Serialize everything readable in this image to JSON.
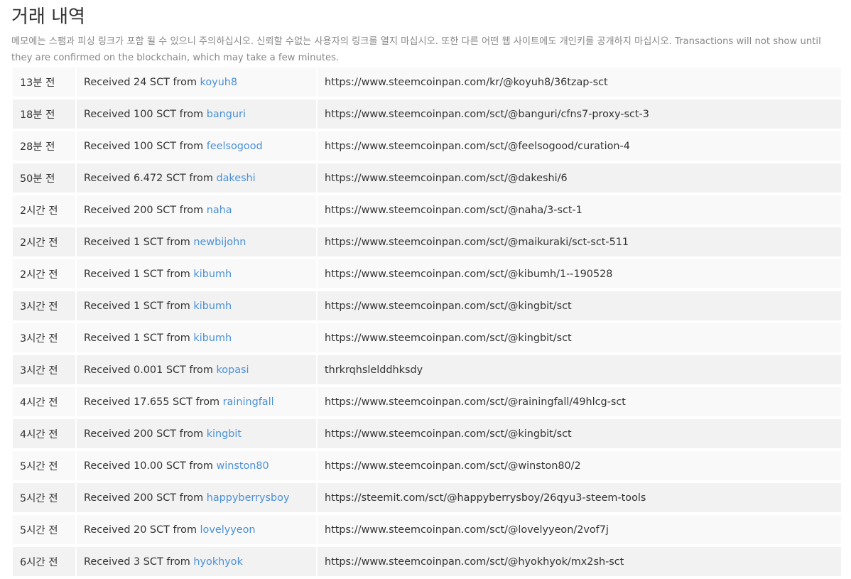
{
  "page": {
    "title": "거래 내역",
    "notice": "메모에는 스팸과 피싱 링크가 포함 될 수 있으니 주의하십시오. 신뢰할 수없는 사용자의 링크를 열지 마십시오. 또한 다른 어떤 웹 사이트에도 개인키를 공개하지 마십시오. Transactions will not show until they are confirmed on the blockchain, which may take a few minutes."
  },
  "colors": {
    "link": "#4a90d9",
    "text": "#333333",
    "muted": "#878787",
    "row_odd": "#f9f9f9",
    "row_even": "#f2f2f2"
  },
  "transactions": [
    {
      "time": "13분 전",
      "prefix": "Received 24 SCT from ",
      "sender": "koyuh8",
      "memo": "https://www.steemcoinpan.com/kr/@koyuh8/36tzap-sct"
    },
    {
      "time": "18분 전",
      "prefix": "Received 100 SCT from ",
      "sender": "banguri",
      "memo": "https://www.steemcoinpan.com/sct/@banguri/cfns7-proxy-sct-3"
    },
    {
      "time": "28분 전",
      "prefix": "Received 100 SCT from ",
      "sender": "feelsogood",
      "memo": "https://www.steemcoinpan.com/sct/@feelsogood/curation-4"
    },
    {
      "time": "50분 전",
      "prefix": "Received 6.472 SCT from ",
      "sender": "dakeshi",
      "memo": "https://www.steemcoinpan.com/sct/@dakeshi/6"
    },
    {
      "time": "2시간 전",
      "prefix": "Received 200 SCT from ",
      "sender": "naha",
      "memo": "https://www.steemcoinpan.com/sct/@naha/3-sct-1"
    },
    {
      "time": "2시간 전",
      "prefix": "Received 1 SCT from ",
      "sender": "newbijohn",
      "memo": "https://www.steemcoinpan.com/sct/@maikuraki/sct-sct-511"
    },
    {
      "time": "2시간 전",
      "prefix": "Received 1 SCT from ",
      "sender": "kibumh",
      "memo": "https://www.steemcoinpan.com/sct/@kibumh/1--190528"
    },
    {
      "time": "3시간 전",
      "prefix": "Received 1 SCT from ",
      "sender": "kibumh",
      "memo": "https://www.steemcoinpan.com/sct/@kingbit/sct"
    },
    {
      "time": "3시간 전",
      "prefix": "Received 1 SCT from ",
      "sender": "kibumh",
      "memo": "https://www.steemcoinpan.com/sct/@kingbit/sct"
    },
    {
      "time": "3시간 전",
      "prefix": "Received 0.001 SCT from ",
      "sender": "kopasi",
      "memo": "thrkrqhslelddhksdy"
    },
    {
      "time": "4시간 전",
      "prefix": "Received 17.655 SCT from ",
      "sender": "rainingfall",
      "memo": "https://www.steemcoinpan.com/sct/@rainingfall/49hlcg-sct"
    },
    {
      "time": "4시간 전",
      "prefix": "Received 200 SCT from ",
      "sender": "kingbit",
      "memo": "https://www.steemcoinpan.com/sct/@kingbit/sct"
    },
    {
      "time": "5시간 전",
      "prefix": "Received 10.00 SCT from ",
      "sender": "winston80",
      "memo": "https://www.steemcoinpan.com/sct/@winston80/2"
    },
    {
      "time": "5시간 전",
      "prefix": "Received 200 SCT from ",
      "sender": "happyberrysboy",
      "memo": "https://steemit.com/sct/@happyberrysboy/26qyu3-steem-tools"
    },
    {
      "time": "5시간 전",
      "prefix": "Received 20 SCT from ",
      "sender": "lovelyyeon",
      "memo": "https://www.steemcoinpan.com/sct/@lovelyyeon/2vof7j"
    },
    {
      "time": "6시간 전",
      "prefix": "Received 3 SCT from ",
      "sender": "hyokhyok",
      "memo": "https://www.steemcoinpan.com/sct/@hyokhyok/mx2sh-sct"
    }
  ]
}
